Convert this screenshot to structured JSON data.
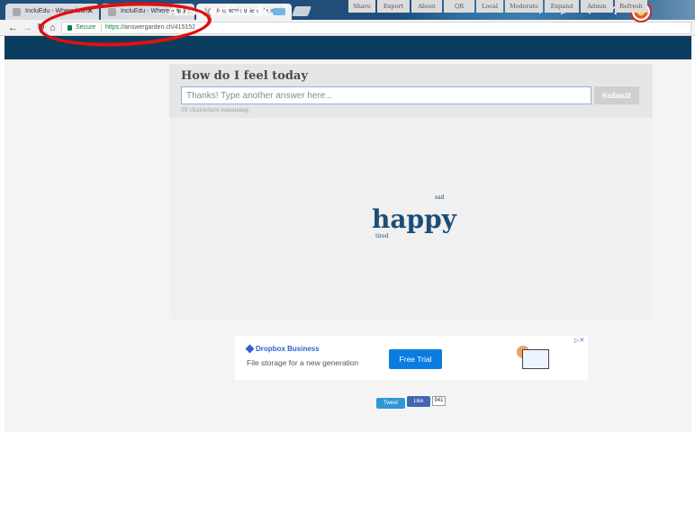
{
  "browser": {
    "tabs": [
      {
        "label": "IncluEdu - Where learn"
      },
      {
        "label": "IncluEdu - Where learni"
      },
      {
        "label": "AnswerGarden - How do"
      }
    ],
    "security_label": "Secure",
    "url_scheme": "https://",
    "url_rest": "answergarden.ch/415152"
  },
  "site": {
    "logo": "AnswerGarden",
    "nav": {
      "add": "+",
      "search": "⌕",
      "heart": "♥",
      "help": "?"
    }
  },
  "question": {
    "title": "How do I feel today",
    "placeholder": "Thanks! Type another answer here...",
    "submit": "Submit",
    "remaining": "50 characters remaining"
  },
  "cloud": {
    "words": [
      {
        "text": "happy",
        "size": "large"
      },
      {
        "text": "sad",
        "size": "small"
      },
      {
        "text": "tired",
        "size": "small"
      }
    ]
  },
  "actions": [
    "Share",
    "Export",
    "About",
    "QR",
    "Local",
    "Moderate",
    "Expand",
    "Admin",
    "Refresh"
  ],
  "ad": {
    "brand": "Dropbox Business",
    "text": "File storage for a new generation",
    "cta": "Free Trial"
  },
  "social": {
    "tweet": "Tweet",
    "like": "Like",
    "like_count": "941"
  },
  "colors": {
    "header": "#0a3d5e",
    "word": "#1c4d78",
    "annotation": "#e01010"
  }
}
